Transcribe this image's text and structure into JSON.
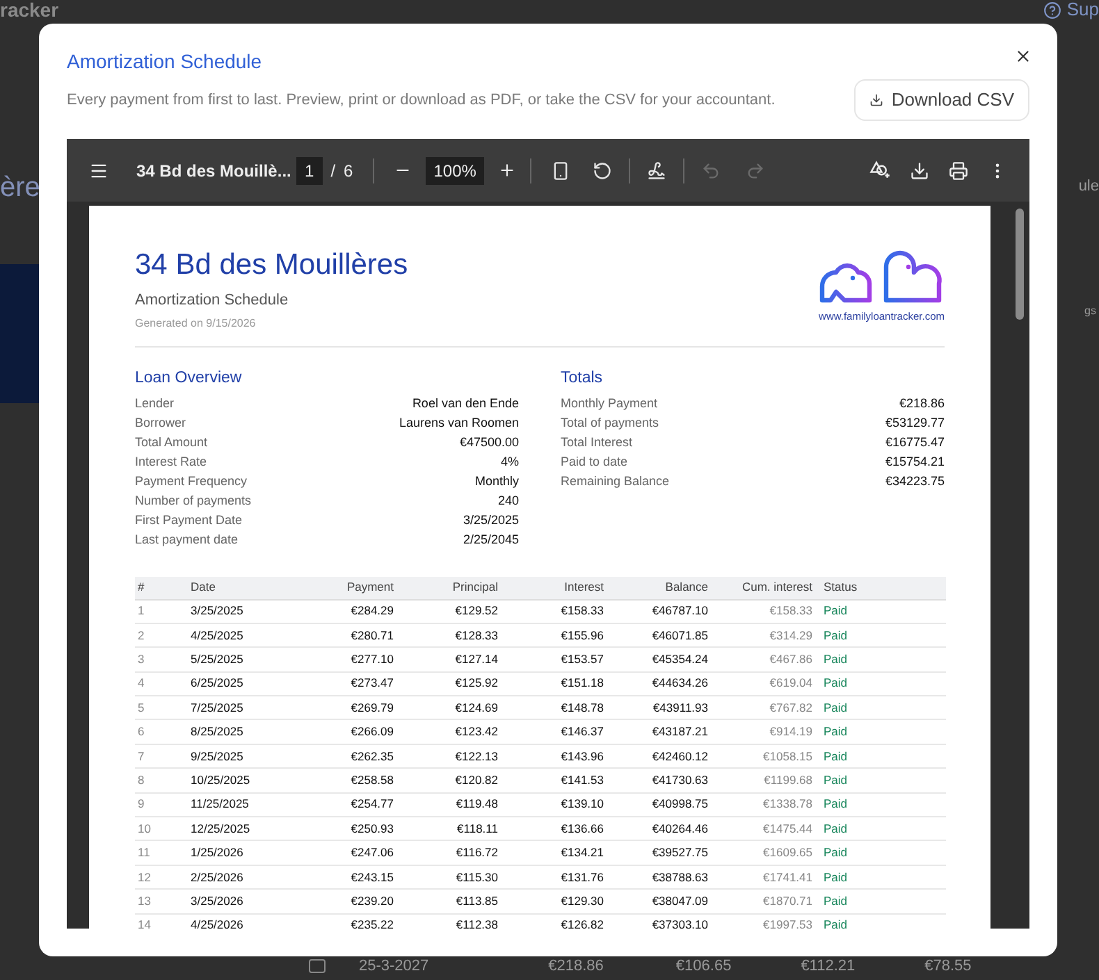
{
  "background": {
    "brand": "racker",
    "support": "Sup",
    "heading": "ère",
    "column": "ule",
    "badge": "gs",
    "checked": false,
    "row": [
      "25-3-2027",
      "€218.86",
      "€106.65",
      "€112.21",
      "€78.55"
    ]
  },
  "dialog": {
    "title": "Amortization Schedule",
    "description": "Every payment from first to last. Preview, print or download as PDF, or take the CSV for your accountant.",
    "download_button": "Download CSV"
  },
  "viewer": {
    "document_title": "34 Bd des Mouillè...",
    "page": "1",
    "page_separator": "/",
    "page_count": "6",
    "zoom": "100%",
    "tools": [
      {
        "kind": "fit",
        "disabled": false
      },
      {
        "kind": "rotate",
        "disabled": false
      },
      {
        "kind": "draw",
        "disabled": false
      },
      {
        "kind": "undo",
        "disabled": true
      },
      {
        "kind": "redo",
        "disabled": true
      }
    ]
  },
  "pdf": {
    "title": "34 Bd des Mouillères",
    "subtitle": "Amortization Schedule",
    "generated": "Generated on 9/15/2026",
    "website": "www.familyloantracker.com",
    "overview": {
      "heading": "Loan Overview",
      "rows": [
        {
          "label": "Lender",
          "value": "Roel van den Ende"
        },
        {
          "label": "Borrower",
          "value": "Laurens van Roomen"
        },
        {
          "label": "Total Amount",
          "value": "€47500.00"
        },
        {
          "label": "Interest Rate",
          "value": "4%"
        },
        {
          "label": "Payment Frequency",
          "value": "Monthly"
        },
        {
          "label": "Number of payments",
          "value": "240"
        },
        {
          "label": "First Payment Date",
          "value": "3/25/2025"
        },
        {
          "label": "Last payment date",
          "value": "2/25/2045"
        }
      ]
    },
    "totals": {
      "heading": "Totals",
      "rows": [
        {
          "label": "Monthly Payment",
          "value": "€218.86"
        },
        {
          "label": "Total of payments",
          "value": "€53129.77"
        },
        {
          "label": "Total Interest",
          "value": "€16775.47"
        },
        {
          "label": "Paid to date",
          "value": "€15754.21"
        },
        {
          "label": "Remaining Balance",
          "value": "€34223.75"
        }
      ]
    },
    "table": {
      "columns": [
        "#",
        "Date",
        "Payment",
        "Principal",
        "Interest",
        "Balance",
        "Cum. interest",
        "Status"
      ],
      "rows": [
        [
          "1",
          "3/25/2025",
          "€284.29",
          "€129.52",
          "€158.33",
          "€46787.10",
          "€158.33",
          "Paid"
        ],
        [
          "2",
          "4/25/2025",
          "€280.71",
          "€128.33",
          "€155.96",
          "€46071.85",
          "€314.29",
          "Paid"
        ],
        [
          "3",
          "5/25/2025",
          "€277.10",
          "€127.14",
          "€153.57",
          "€45354.24",
          "€467.86",
          "Paid"
        ],
        [
          "4",
          "6/25/2025",
          "€273.47",
          "€125.92",
          "€151.18",
          "€44634.26",
          "€619.04",
          "Paid"
        ],
        [
          "5",
          "7/25/2025",
          "€269.79",
          "€124.69",
          "€148.78",
          "€43911.93",
          "€767.82",
          "Paid"
        ],
        [
          "6",
          "8/25/2025",
          "€266.09",
          "€123.42",
          "€146.37",
          "€43187.21",
          "€914.19",
          "Paid"
        ],
        [
          "7",
          "9/25/2025",
          "€262.35",
          "€122.13",
          "€143.96",
          "€42460.12",
          "€1058.15",
          "Paid"
        ],
        [
          "8",
          "10/25/2025",
          "€258.58",
          "€120.82",
          "€141.53",
          "€41730.63",
          "€1199.68",
          "Paid"
        ],
        [
          "9",
          "11/25/2025",
          "€254.77",
          "€119.48",
          "€139.10",
          "€40998.75",
          "€1338.78",
          "Paid"
        ],
        [
          "10",
          "12/25/2025",
          "€250.93",
          "€118.11",
          "€136.66",
          "€40264.46",
          "€1475.44",
          "Paid"
        ],
        [
          "11",
          "1/25/2026",
          "€247.06",
          "€116.72",
          "€134.21",
          "€39527.75",
          "€1609.65",
          "Paid"
        ],
        [
          "12",
          "2/25/2026",
          "€243.15",
          "€115.30",
          "€131.76",
          "€38788.63",
          "€1741.41",
          "Paid"
        ],
        [
          "13",
          "3/25/2026",
          "€239.20",
          "€113.85",
          "€129.30",
          "€38047.09",
          "€1870.71",
          "Paid"
        ],
        [
          "14",
          "4/25/2026",
          "€235.22",
          "€112.38",
          "€126.82",
          "€37303.10",
          "€1997.53",
          "Paid"
        ]
      ]
    }
  }
}
